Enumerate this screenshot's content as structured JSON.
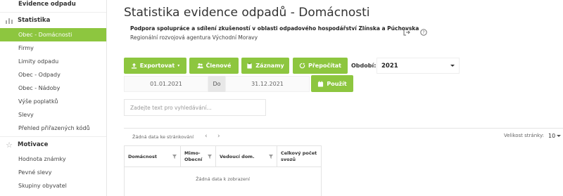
{
  "sidebar": {
    "evidence_label": "Evidence odpadu",
    "statistika_label": "Statistika",
    "statistika_items": [
      "Obec - Domácnosti",
      "Firmy",
      "Limity odpadu",
      "Obec - Odpady",
      "Obec - Nádoby",
      "Výše poplatků",
      "Slevy",
      "Přehled přiřazených kódů"
    ],
    "motivace_label": "Motivace",
    "motivace_items": [
      "Hodnota známky",
      "Pevné slevy",
      "Skupiny obyvatel"
    ]
  },
  "header": {
    "title": "Statistika evidence odpadů - Domácnosti",
    "subtitle_bold": "Podpora spolupráce a sdílení zkušeností v oblasti odpadového hospodářství Zlínska a Púchovska",
    "subtitle": "Regionální rozvojová agentura Východní Moravy"
  },
  "toolbar": {
    "export_label": "Exportovat",
    "members_label": "Členové",
    "records_label": "Záznamy",
    "recalc_label": "Přepočítat",
    "period_label": "Období:",
    "period_value": "2021",
    "date_from": "01.01.2021",
    "date_sep": "Do",
    "date_to": "31.12.2021",
    "apply_label": "Použít"
  },
  "search": {
    "placeholder": "Zadejte text pro vyhledávání..."
  },
  "grid": {
    "no_paging": "Žádná data ke stránkování",
    "page_size_label": "Velikost stránky:",
    "page_size_value": "10",
    "columns": [
      "Domácnost",
      "Mimo-Obecní",
      "Vedoucí dom.",
      "Celkový počet svozů"
    ],
    "col_mimo_1": "Mimo-",
    "col_mimo_2": "Obecní",
    "col_celkovy_1": "Celkový počet",
    "col_celkovy_2": "svozů",
    "no_data": "Žádná data k zobrazení"
  },
  "colors": {
    "accent": "#8dc63f"
  }
}
